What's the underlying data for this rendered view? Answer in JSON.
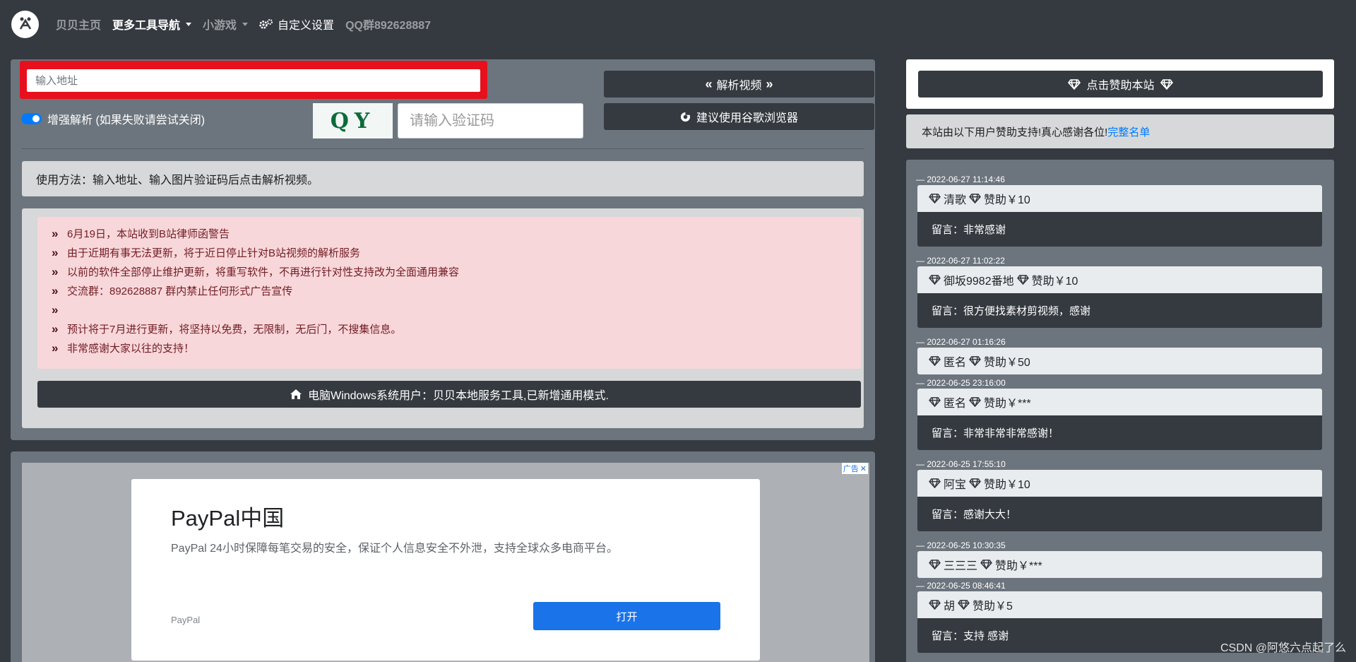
{
  "nav": {
    "home": "贝贝主页",
    "tools": "更多工具导航",
    "games": "小游戏",
    "settings": "自定义设置",
    "qq": "QQ群892628887"
  },
  "parse": {
    "url_placeholder": "输入地址",
    "enhance_label": "增强解析 (如果失败请尝试关闭)",
    "captcha_text": "QY",
    "captcha_placeholder": "请输入验证码",
    "parse_button": "解析视频",
    "chrome_button": "建议使用谷歌浏览器",
    "usage": "使用方法：输入地址、输入图片验证码后点击解析视频。"
  },
  "notices": [
    "6月19日，本站收到B站律师函警告",
    "由于近期有事无法更新，将于近日停止针对B站视频的解析服务",
    "以前的软件全部停止维护更新，将重写软件，不再进行针对性支持改为全面通用兼容",
    "交流群：892628887 群内禁止任何形式广告宣传",
    "",
    "预计将于7月进行更新，将坚持以免费，无限制，无后门，不搜集信息。",
    "非常感谢大家以往的支持！"
  ],
  "windows_button": "电脑Windows系统用户：贝贝本地服务工具,已新增通用模式.",
  "ad": {
    "badge": "广告",
    "title": "PayPal中国",
    "desc": "PayPal 24小时保障每笔交易的安全，保证个人信息安全不外泄，支持全球众多电商平台。",
    "brand": "PayPal",
    "open": "打开"
  },
  "sponsor": {
    "button": "点击赞助本站",
    "thanks_prefix": "本站由以下用户赞助支持!真心感谢各位!",
    "thanks_link": "完整名单"
  },
  "entries": [
    {
      "date": "— 2022-06-27 11:14:46",
      "name": "清歌",
      "amount": "赞助￥10",
      "msg": "留言：非常感谢"
    },
    {
      "date": "— 2022-06-27 11:02:22",
      "name": "御坂9982番地",
      "amount": "赞助￥10",
      "msg": "留言：很方便找素材剪视频，感谢"
    },
    {
      "date": "— 2022-06-27 01:16:26",
      "name": "匿名",
      "amount": "赞助￥50",
      "msg": ""
    },
    {
      "date": "— 2022-06-25 23:16:00",
      "name": "匿名",
      "amount": "赞助￥***",
      "msg": "留言：非常非常非常感谢！"
    },
    {
      "date": "— 2022-06-25 17:55:10",
      "name": "阿宝",
      "amount": "赞助￥10",
      "msg": "留言：感谢大大！"
    },
    {
      "date": "— 2022-06-25 10:30:35",
      "name": "三三三",
      "amount": "赞助￥***",
      "msg": ""
    },
    {
      "date": "— 2022-06-25 08:46:41",
      "name": "胡",
      "amount": "赞助￥5",
      "msg": "留言：支持 感谢"
    }
  ],
  "watermark": "CSDN @阿悠六点起了么"
}
